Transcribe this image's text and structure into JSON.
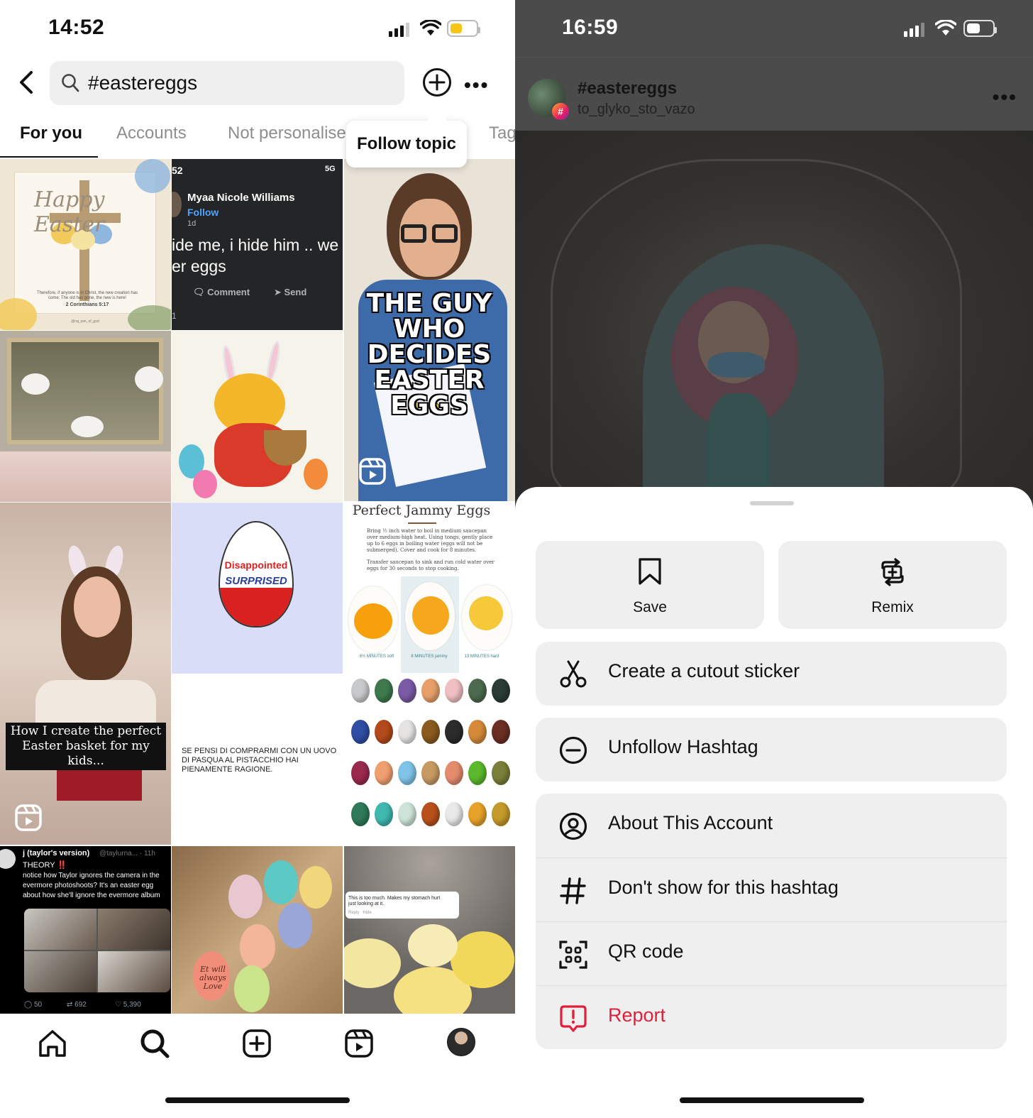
{
  "left": {
    "status": {
      "time": "14:52"
    },
    "search": {
      "query": "#eastereggs"
    },
    "tabs": [
      "For you",
      "Accounts",
      "Not personalised",
      "Tags"
    ],
    "tooltip": "Follow topic",
    "tiles": {
      "easter_card": {
        "script": "Happy Easter",
        "verse": "Therefore, if anyone is in Christ, the new creation has come: The old has gone, the new is here!",
        "ref": "2 Corinthians 5:17",
        "handle": "@raj_son_of_god"
      },
      "fb_post": {
        "status": "52",
        "network": "5G",
        "name": "Myaa Nicole Williams",
        "follow": "Follow",
        "meta": "1d",
        "line1": "ide me, i hide him .. we",
        "line2": "er eggs",
        "comment": "Comment",
        "send": "Send",
        "count": "1"
      },
      "guy": {
        "line1": "THE GUY",
        "line2": "WHO DECIDES",
        "line3": "EASTER EGGS",
        "paper": "DID"
      },
      "disappointed": {
        "top": "Disappointed",
        "bottom": "SURPRISED"
      },
      "jammy": {
        "title": "Perfect Jammy Eggs",
        "p1": "Bring ½ inch water to boil in medium saucepan over medium-high heat. Using tongs, gently place up to 6 eggs in boiling water (eggs will not be submerged). Cover and cook for 8 minutes.",
        "p2": "Transfer saucepan to sink and run cold water over eggs for 30 seconds to stop cooking.",
        "labels": [
          "6½ MINUTES soft",
          "8 MINUTES jammy",
          "13 MINUTES hard"
        ]
      },
      "basket_caption": "How I create the perfect Easter basket for my kids...",
      "italian": "SE PENSI DI COMPRARMI CON UN UOVO DI PASQUA AL PISTACCHIO HAI PIENAMENTE RAGIONE.",
      "tweet": {
        "name": "j (taylor's version)",
        "handle": "@taylurna... · 11h",
        "theory": "THEORY ‼️",
        "body": "notice how Taylor ignores the camera in the evermore photoshoots? It's an easter egg about how she'll ignore the evermore album",
        "replies": "50",
        "retweets": "692",
        "likes": "5,390"
      },
      "eggs_carton": "Et will always Love",
      "deviled_comment": "This is too much. Makes my stomach hurt just looking at it.",
      "deviled_actions": "Reply   Hide"
    }
  },
  "right": {
    "status": {
      "time": "16:59"
    },
    "header": {
      "title": "#eastereggs",
      "subtitle": "to_glyko_sto_vazo",
      "badge": "#"
    },
    "sheet": {
      "save": "Save",
      "remix": "Remix",
      "cutout": "Create a cutout sticker",
      "unfollow": "Unfollow Hashtag",
      "about": "About This Account",
      "dont_show": "Don't show for this hashtag",
      "qr": "QR code",
      "report": "Report"
    }
  },
  "colors": {
    "report_red": "#e0203a",
    "battery_yellow": "#f5c518",
    "follow_blue": "#4da3ff"
  }
}
